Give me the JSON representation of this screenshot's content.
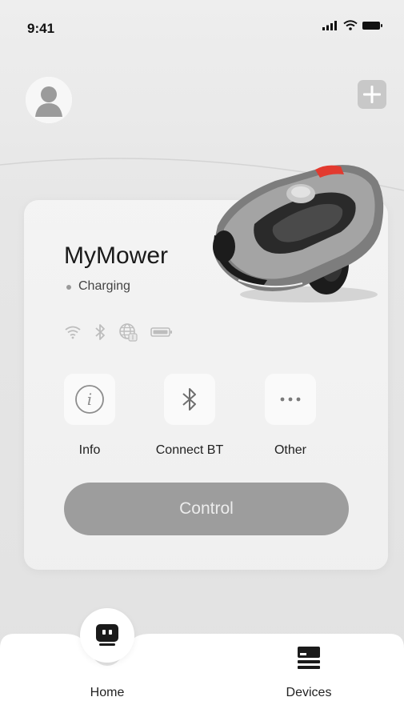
{
  "status_bar": {
    "time": "9:41"
  },
  "header": {
    "avatar_icon": "user-avatar-icon",
    "add_icon": "plus-icon"
  },
  "device": {
    "name": "MyMower",
    "status": "Charging",
    "connectivity_icons": [
      "wifi-icon",
      "bluetooth-icon",
      "globe-icon",
      "battery-icon"
    ]
  },
  "actions": [
    {
      "label": "Info",
      "icon": "info-icon"
    },
    {
      "label": "Connect BT",
      "icon": "bluetooth-icon"
    },
    {
      "label": "Other",
      "icon": "more-icon"
    }
  ],
  "control": {
    "label": "Control",
    "color": "#9d9d9d"
  },
  "tabbar": {
    "tabs": [
      {
        "label": "Home",
        "icon": "robot-icon",
        "active": true
      },
      {
        "label": "Devices",
        "icon": "devices-icon",
        "active": false
      }
    ]
  }
}
